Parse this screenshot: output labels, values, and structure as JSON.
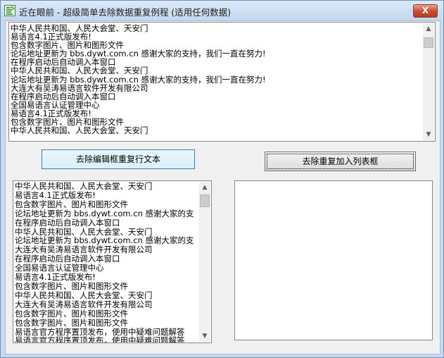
{
  "window": {
    "title": "近在眼前 - 超级简单去除数据重复例程 (适用任何数据)",
    "close_label": "X"
  },
  "memo": {
    "lines": [
      "中华人民共和国、人民大会堂、天安门",
      "易语言4.1正式版发布!",
      "包含数字图片、图片和图形文件",
      "论坛地址更新为 bbs.dywt.com.cn 感谢大家的支持，我们一直在努力!",
      "在程序启动后自动调入本窗口",
      "中华人民共和国、人民大会堂、天安门",
      "论坛地址更新为 bbs.dywt.com.cn 感谢大家的支持，我们一直在努力!",
      "大连大有吴涛易语言软件开发有限公司",
      "在程序启动后自动调入本窗口",
      "全国易语言认证管理中心",
      "易语言4.1正式版发布!",
      "包含数字图片、图片和图形文件",
      "中华人民共和国、人民大会堂、天安门"
    ]
  },
  "buttons": {
    "remove_edit_dup": "去除编辑框重复行文本",
    "remove_list_dup": "去除重复加入列表框"
  },
  "left_list": {
    "items": [
      "中华人民共和国、人民大会堂、天安门",
      "易语言4.1正式版发布!",
      "包含数字图片、图片和图形文件",
      "论坛地址更新为 bbs.dywt.com.cn 感谢大家的支",
      "在程序启动后自动调入本窗口",
      "中华人民共和国、人民大会堂、天安门",
      "论坛地址更新为 bbs.dywt.com.cn 感谢大家的支",
      "大连大有吴涛易语言软件开发有限公司",
      "在程序启动后自动调入本窗口",
      "全国易语言认证管理中心",
      "易语言4.1正式版发布!",
      "包含数字图片、图片和图形文件",
      "中华人民共和国、人民大会堂、天安门",
      "大连大有吴涛易语言软件开发有限公司",
      "包含数字图片、图片和图形文件",
      "包含数字图片、图片和图形文件",
      "易语言官方程序置顶发布，使用中疑难问题解答",
      "易语言官方程序置顶发布，使用中疑难问题解答"
    ]
  },
  "right_list": {
    "items": []
  },
  "icons": {
    "app": "app-icon",
    "scroll_up": "scroll-up-icon",
    "scroll_down": "scroll-down-icon"
  }
}
